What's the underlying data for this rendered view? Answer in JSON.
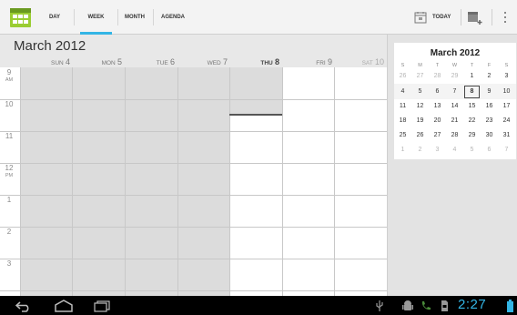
{
  "action_bar": {
    "tabs": [
      {
        "label": "DAY"
      },
      {
        "label": "WEEK"
      },
      {
        "label": "MONTH"
      },
      {
        "label": "AGENDA"
      }
    ],
    "selected_tab": "WEEK",
    "today_label": "TODAY",
    "accent_color": "#33b5e5"
  },
  "week_view": {
    "month_title": "March 2012",
    "days": [
      {
        "name": "SUN",
        "num": "4"
      },
      {
        "name": "MON",
        "num": "5"
      },
      {
        "name": "TUE",
        "num": "6"
      },
      {
        "name": "WED",
        "num": "7"
      },
      {
        "name": "THU",
        "num": "8"
      },
      {
        "name": "FRI",
        "num": "9"
      },
      {
        "name": "SAT",
        "num": "10"
      }
    ],
    "hours": [
      {
        "h": "9",
        "ampm": "AM"
      },
      {
        "h": "10",
        "ampm": ""
      },
      {
        "h": "11",
        "ampm": ""
      },
      {
        "h": "12",
        "ampm": "PM"
      },
      {
        "h": "1",
        "ampm": ""
      },
      {
        "h": "2",
        "ampm": ""
      },
      {
        "h": "3",
        "ampm": ""
      }
    ]
  },
  "mini_calendar": {
    "title": "March 2012",
    "dow": [
      "S",
      "M",
      "T",
      "W",
      "T",
      "F",
      "S"
    ],
    "weeks": [
      [
        "26",
        "27",
        "28",
        "29",
        "1",
        "2",
        "3"
      ],
      [
        "4",
        "5",
        "6",
        "7",
        "8",
        "9",
        "10"
      ],
      [
        "11",
        "12",
        "13",
        "14",
        "15",
        "16",
        "17"
      ],
      [
        "18",
        "19",
        "20",
        "21",
        "22",
        "23",
        "24"
      ],
      [
        "25",
        "26",
        "27",
        "28",
        "29",
        "30",
        "31"
      ],
      [
        "1",
        "2",
        "3",
        "4",
        "5",
        "6",
        "7"
      ]
    ],
    "selected_day": "8"
  },
  "system_bar": {
    "clock": "2:27"
  }
}
